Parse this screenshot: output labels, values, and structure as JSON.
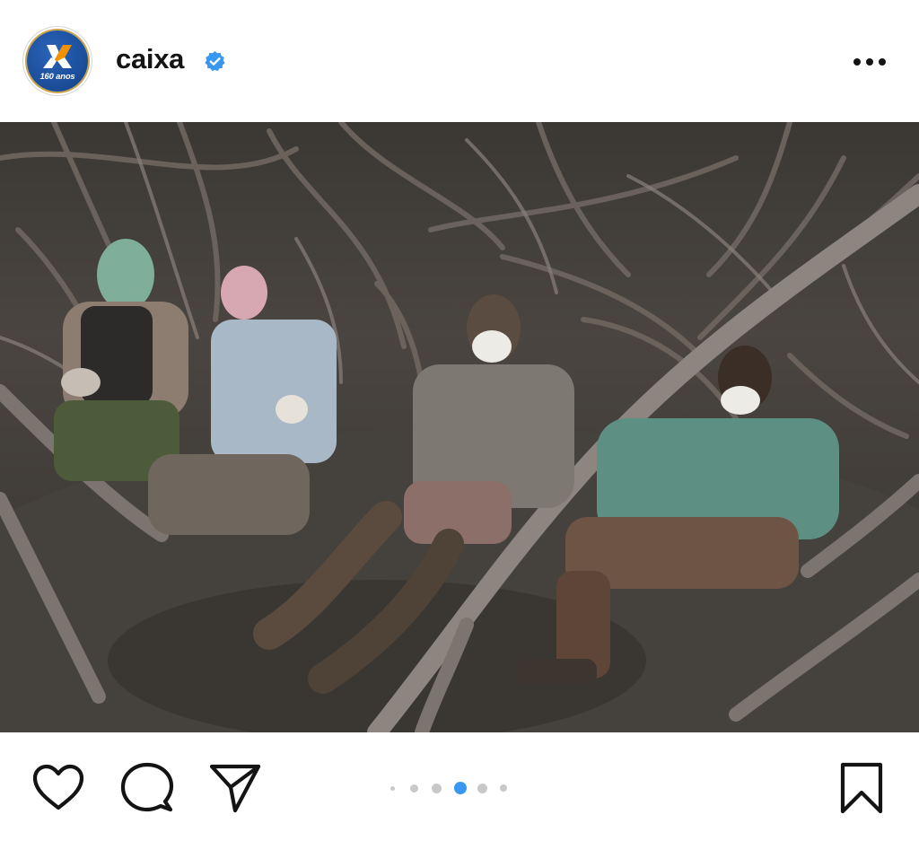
{
  "header": {
    "username": "caixa",
    "avatar_caption": "160 anos",
    "verified_color": "#3897f0"
  },
  "photo": {
    "icon": "post-image"
  },
  "actions": {
    "icons": [
      "heart-icon",
      "comment-icon",
      "share-icon",
      "bookmark-icon"
    ]
  },
  "carousel": {
    "total": 6,
    "active_index": 3,
    "active_color": "#3897f0",
    "inactive_color": "#c8c8c8"
  }
}
